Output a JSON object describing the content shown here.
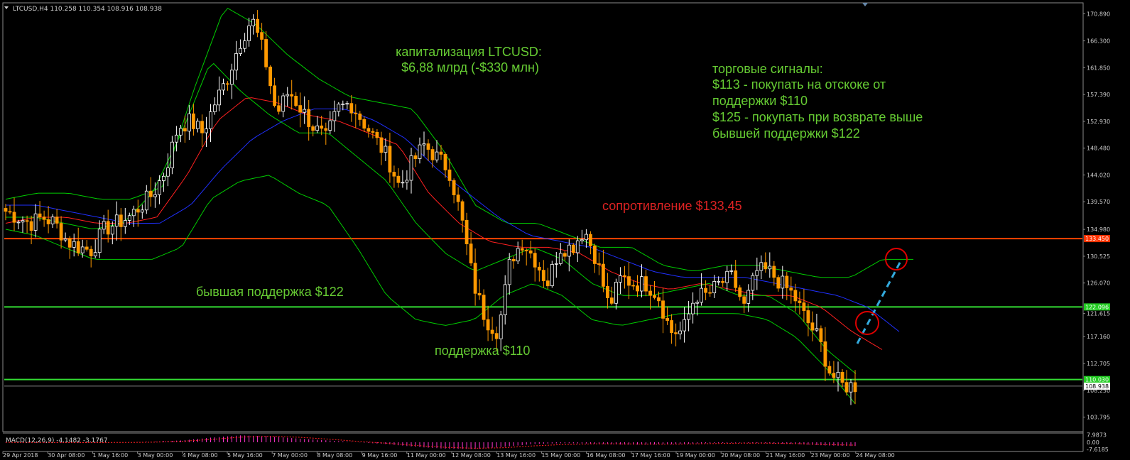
{
  "symbol_header": "LTCUSD,H4  110.258 110.354 108.916 108.938",
  "macd_header": "MACD(12,26,9) -4.1482 -3.1767",
  "colors": {
    "background": "#000000",
    "bull_candle": "#ffffff",
    "bear_candle": "#ff9900",
    "ma_fast": "#00cc00",
    "ma_mid": "#ff2020",
    "ma_slow": "#2030ff",
    "bollinger": "#00cc00",
    "resistance_line": "#ff4400",
    "support_line": "#33dd33",
    "macd_hist": "#ff33cc",
    "macd_signal": "#ff2020",
    "projection": "#33aadd",
    "signal_circle": "#dd0000",
    "annotation_green": "#66cc33",
    "annotation_red": "#dd2222"
  },
  "annotations": {
    "cap_line1": "капитализация LTCUSD:",
    "cap_line2": "$6,88 млрд (-$330 млн)",
    "signals_title": "торговые сигналы:",
    "signal1_line1": "$113 - покупать на отскоке от",
    "signal1_line2": "поддержки $110",
    "signal2_line1": "$125 - покупать при возврате выше",
    "signal2_line2": "бывшей поддержки $122",
    "resistance": "сопротивление $133,45",
    "former_support": "бывшая поддержка $122",
    "support": "поддержка $110"
  },
  "chart_data": [
    {
      "type": "candlestick",
      "ylim": [
        101.5,
        172.5
      ],
      "y_ticks": [
        {
          "value": 170.8,
          "label": "170.890"
        },
        {
          "value": 166.3,
          "label": "166.300"
        },
        {
          "value": 161.85,
          "label": "161.850"
        },
        {
          "value": 157.39,
          "label": "157.390"
        },
        {
          "value": 152.93,
          "label": "152.930"
        },
        {
          "value": 148.48,
          "label": "148.480"
        },
        {
          "value": 144.02,
          "label": "144.020"
        },
        {
          "value": 139.57,
          "label": "139.570"
        },
        {
          "value": 134.98,
          "label": "134.980"
        },
        {
          "value": 130.52,
          "label": "130.525"
        },
        {
          "value": 126.07,
          "label": "126.070"
        },
        {
          "value": 121.0,
          "label": "121.615"
        },
        {
          "value": 117.16,
          "label": "117.160"
        },
        {
          "value": 112.7,
          "label": "112.705"
        },
        {
          "value": 108.25,
          "label": "108.250"
        },
        {
          "value": 103.79,
          "label": "103.795"
        }
      ],
      "price_tags": [
        {
          "value": 133.45,
          "label": "133.450",
          "kind": "resistance"
        },
        {
          "value": 122.096,
          "label": "122.096",
          "kind": "support"
        },
        {
          "value": 110.03,
          "label": "110.030",
          "kind": "support"
        },
        {
          "value": 108.938,
          "label": "108.938",
          "kind": "current"
        }
      ],
      "x_labels": [
        "29 Apr 2018",
        "30 Apr 08:00",
        "1 May 16:00",
        "3 May 00:00",
        "4 May 08:00",
        "5 May 16:00",
        "7 May 00:00",
        "8 May 08:00",
        "9 May 16:00",
        "11 May 00:00",
        "12 May 08:00",
        "13 May 16:00",
        "15 May 00:00",
        "16 May 08:00",
        "17 May 16:00",
        "19 May 00:00",
        "20 May 08:00",
        "21 May 16:00",
        "23 May 00:00",
        "24 May 08:00"
      ],
      "x_start": "2018-04-29 00:00",
      "timeframe": "H4",
      "candle_close_anchors": [
        138,
        137,
        136,
        137,
        136,
        133,
        132,
        131.5,
        135,
        136,
        137,
        139,
        141,
        145,
        152,
        153,
        151,
        156,
        160,
        166,
        170,
        164,
        154,
        158,
        155,
        152,
        150,
        155,
        156,
        153,
        150,
        147,
        142,
        146,
        149,
        147,
        145,
        137,
        126,
        120,
        118,
        130,
        133,
        130,
        126,
        132,
        132,
        135,
        130,
        122,
        127,
        126,
        126,
        124,
        118,
        118,
        124,
        124,
        126,
        127,
        122,
        128,
        128,
        126,
        124,
        120,
        117,
        111,
        109,
        109
      ],
      "indicators": {
        "ma_fast_anchors": [
          137,
          137,
          136,
          135,
          136,
          141,
          151,
          163,
          158,
          154,
          151,
          151,
          147,
          143,
          136,
          131,
          128,
          130,
          132,
          130,
          126,
          124,
          124,
          125,
          126,
          124,
          124,
          121,
          115,
          111
        ],
        "ma_mid_anchors": [
          136,
          137,
          137,
          136,
          136,
          137,
          144,
          153,
          157,
          156,
          154,
          153,
          151,
          149,
          141,
          136,
          133,
          132,
          132,
          131,
          128,
          126,
          125,
          126,
          125,
          124,
          124,
          122,
          118,
          115
        ],
        "ma_slow_anchors": [
          139,
          139,
          138,
          137,
          136,
          136,
          139,
          145,
          150,
          153,
          155,
          155,
          153,
          150,
          145,
          141,
          137,
          134,
          133,
          132,
          130,
          128,
          127,
          127,
          127,
          126,
          125,
          124,
          122,
          118
        ],
        "bb_upper_anchors": [
          140,
          141,
          141,
          140,
          140,
          142,
          158,
          172,
          169,
          164,
          160,
          157,
          156,
          155,
          148,
          139,
          136,
          136,
          134,
          132,
          132,
          129,
          128,
          129,
          129,
          128,
          127,
          127,
          130,
          130
        ],
        "bb_lower_anchors": [
          135,
          134,
          132,
          130,
          130,
          130,
          132,
          140,
          143,
          144,
          141,
          139,
          132,
          124,
          120,
          119,
          120,
          124,
          126,
          124,
          120,
          119,
          120,
          121,
          121,
          121,
          120,
          117,
          112,
          106
        ]
      },
      "horizontal_lines": [
        133.45,
        122.096,
        110.03,
        108.938
      ]
    },
    {
      "type": "bar",
      "name": "MACD(12,26,9)",
      "ylim": [
        -8.5,
        8.5
      ],
      "y_ticks": [
        {
          "value": 7.9873,
          "label": "7.9873"
        },
        {
          "value": 0.0,
          "label": "0.00"
        },
        {
          "value": -7.6185,
          "label": "-7.6185"
        }
      ],
      "histogram_anchors": [
        -0.2,
        -0.4,
        -0.5,
        -0.3,
        0,
        0.5,
        2,
        5,
        7.5,
        6.5,
        4,
        2,
        0,
        -2,
        -5,
        -7,
        -7.5,
        -5,
        -2,
        -1,
        -1.5,
        -2.5,
        -2.5,
        -2,
        -1,
        -0.5,
        -1,
        -2,
        -3.5,
        -4.1
      ],
      "signal_anchors": [
        -0.1,
        -0.2,
        -0.3,
        -0.4,
        -0.2,
        0,
        1,
        3,
        5.5,
        6.5,
        5.5,
        3.5,
        1,
        -1,
        -3.5,
        -5.5,
        -6.5,
        -6,
        -4,
        -2.5,
        -1.8,
        -1.8,
        -2,
        -2,
        -1.5,
        -1,
        -1,
        -1.5,
        -2.5,
        -3.2
      ]
    }
  ]
}
